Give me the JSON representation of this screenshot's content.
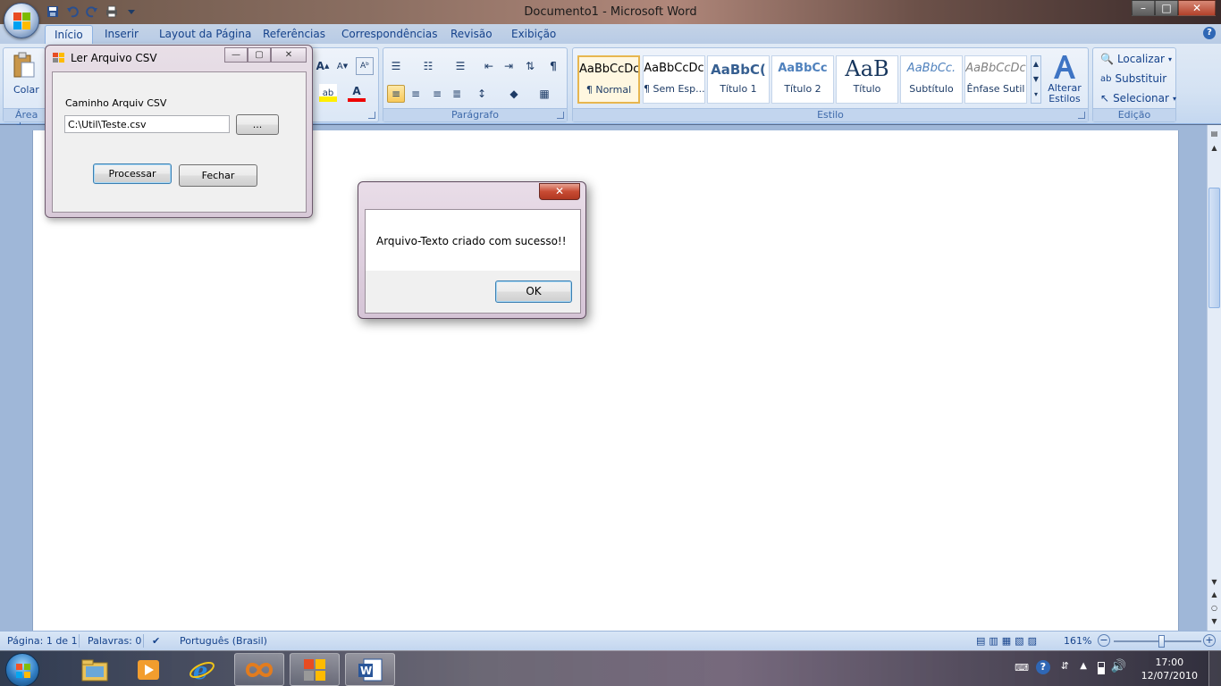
{
  "window": {
    "title": "Documento1 - Microsoft Word",
    "controls": [
      "–",
      "□",
      "✕"
    ]
  },
  "tabs": [
    "Início",
    "Inserir",
    "Layout da Página",
    "Referências",
    "Correspondências",
    "Revisão",
    "Exibição"
  ],
  "ribbon": {
    "clipboard": {
      "paste_label": "Colar",
      "group_label": "Área d"
    },
    "paragraph": {
      "group_label": "Parágrafo"
    },
    "styles": {
      "group_label": "Estilo",
      "tiles": [
        {
          "sample": "AaBbCcDc",
          "name": "¶ Normal"
        },
        {
          "sample": "AaBbCcDc",
          "name": "¶ Sem Esp..."
        },
        {
          "sample": "AaBbC(",
          "name": "Título 1"
        },
        {
          "sample": "AaBbCc",
          "name": "Título 2"
        },
        {
          "sample": "AaB",
          "name": "Título"
        },
        {
          "sample": "AaBbCc.",
          "name": "Subtítulo"
        },
        {
          "sample": "AaBbCcDc",
          "name": "Ênfase Sutil"
        }
      ],
      "change_styles_label_1": "Alterar",
      "change_styles_label_2": "Estilos"
    },
    "editing": {
      "group_label": "Edição",
      "find": "Localizar",
      "replace": "Substituir",
      "select": "Selecionar"
    }
  },
  "csv_window": {
    "title": "Ler Arquivo CSV",
    "path_label": "Caminho Arquiv CSV",
    "path_value": "C:\\Util\\Teste.csv",
    "browse_label": "...",
    "process_label": "Processar",
    "close_label": "Fechar"
  },
  "message_box": {
    "text": "Arquivo-Texto criado com sucesso!!",
    "ok_label": "OK",
    "close_symbol": "✕"
  },
  "statusbar": {
    "page": "Página: 1 de 1",
    "words": "Palavras: 0",
    "language": "Português (Brasil)",
    "zoom": "161%"
  },
  "taskbar": {
    "time": "17:00",
    "date": "12/07/2010"
  },
  "colors": {
    "ribbon_text": "#15428b",
    "title_bar": "#8a6e61",
    "selected_style": "#e7b64f"
  }
}
